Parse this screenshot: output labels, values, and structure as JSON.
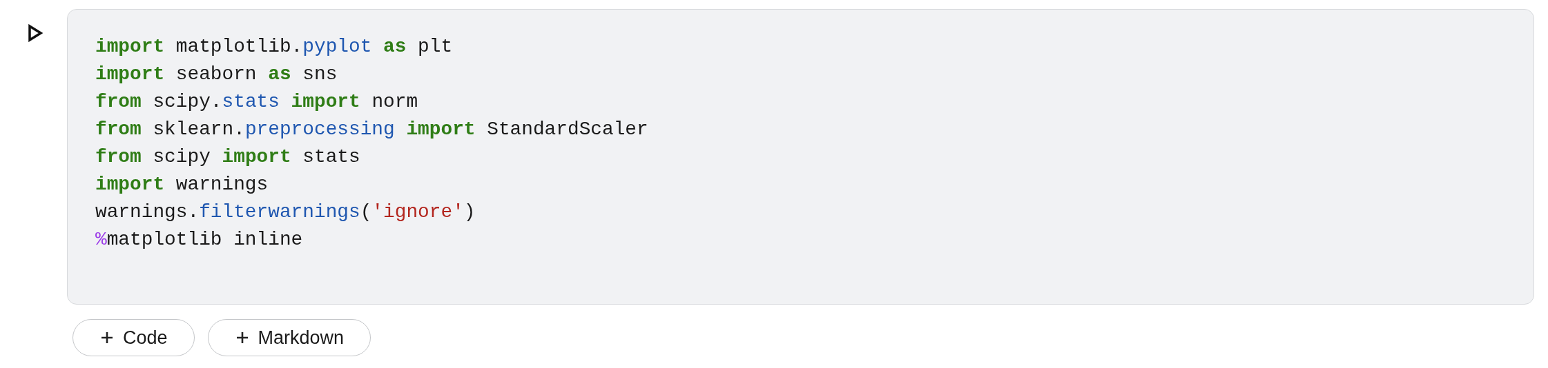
{
  "cell": {
    "code_lines": [
      [
        {
          "kind": "keyword",
          "text": "import"
        },
        {
          "kind": "plain",
          "text": " matplotlib."
        },
        {
          "kind": "attr",
          "text": "pyplot "
        },
        {
          "kind": "keyword",
          "text": "as"
        },
        {
          "kind": "plain",
          "text": " plt"
        }
      ],
      [
        {
          "kind": "keyword",
          "text": "import"
        },
        {
          "kind": "plain",
          "text": " seaborn "
        },
        {
          "kind": "keyword",
          "text": "as"
        },
        {
          "kind": "plain",
          "text": " sns"
        }
      ],
      [
        {
          "kind": "keyword",
          "text": "from"
        },
        {
          "kind": "plain",
          "text": " scipy."
        },
        {
          "kind": "attr",
          "text": "stats "
        },
        {
          "kind": "keyword",
          "text": "import"
        },
        {
          "kind": "plain",
          "text": " norm"
        }
      ],
      [
        {
          "kind": "keyword",
          "text": "from"
        },
        {
          "kind": "plain",
          "text": " sklearn."
        },
        {
          "kind": "attr",
          "text": "preprocessing "
        },
        {
          "kind": "keyword",
          "text": "import"
        },
        {
          "kind": "plain",
          "text": " StandardScaler"
        }
      ],
      [
        {
          "kind": "keyword",
          "text": "from"
        },
        {
          "kind": "plain",
          "text": " scipy "
        },
        {
          "kind": "keyword",
          "text": "import"
        },
        {
          "kind": "plain",
          "text": " stats"
        }
      ],
      [
        {
          "kind": "keyword",
          "text": "import"
        },
        {
          "kind": "plain",
          "text": " warnings"
        }
      ],
      [
        {
          "kind": "plain",
          "text": "warnings."
        },
        {
          "kind": "attr",
          "text": "filterwarnings"
        },
        {
          "kind": "plain",
          "text": "("
        },
        {
          "kind": "string",
          "text": "'ignore'"
        },
        {
          "kind": "plain",
          "text": ")"
        }
      ],
      [
        {
          "kind": "magic",
          "text": "%"
        },
        {
          "kind": "plain",
          "text": "matplotlib inline"
        }
      ]
    ]
  },
  "add_buttons": [
    {
      "label": "Code"
    },
    {
      "label": "Markdown"
    }
  ]
}
